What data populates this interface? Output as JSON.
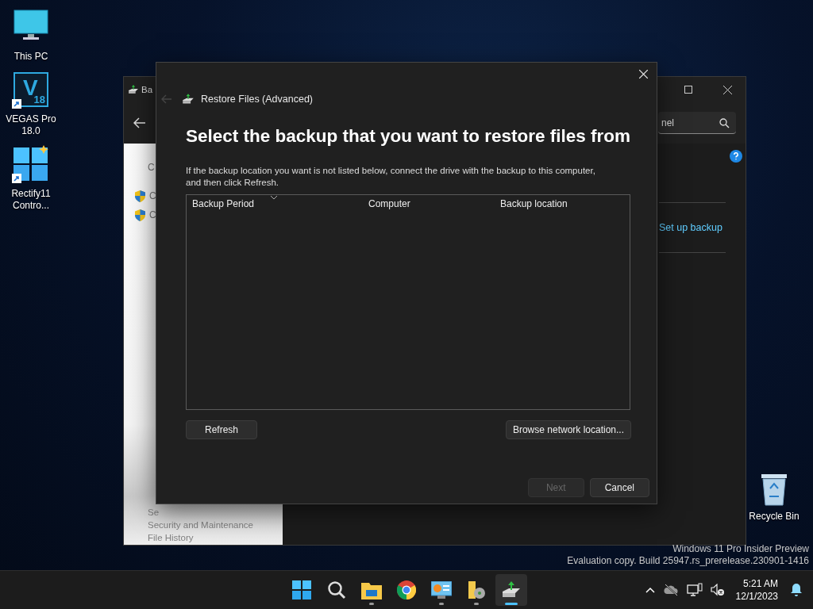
{
  "desktop_icons": [
    {
      "kind": "pc",
      "label": "This PC",
      "shortcut": false
    },
    {
      "kind": "vegas",
      "label": "VEGAS Pro 18.0",
      "glyph": "V",
      "version": "18",
      "shortcut": true
    },
    {
      "kind": "rectify",
      "label": "Rectify11 Contro...",
      "shortcut": true
    }
  ],
  "recycle_bin": {
    "label": "Recycle Bin"
  },
  "background_window": {
    "title": "Ba",
    "search": {
      "placeholder": "nel"
    },
    "sidebar_items": [
      {
        "kind": "plain",
        "label": "C"
      },
      {
        "kind": "shield",
        "label": "C"
      },
      {
        "kind": "shield",
        "label": "C"
      }
    ],
    "see_also": [
      "Se",
      "Security and Maintenance",
      "File History"
    ],
    "link": "Set up backup"
  },
  "dialog": {
    "title": "Restore Files (Advanced)",
    "back_disabled": true,
    "heading": "Select the backup that you want to restore files from",
    "description": "If the backup location you want is not listed below, connect the drive with the backup to this computer, and then click Refresh.",
    "columns": [
      {
        "label": "Backup Period",
        "sorted": true
      },
      {
        "label": "Computer",
        "sorted": false
      },
      {
        "label": "Backup location",
        "sorted": false
      }
    ],
    "list_buttons": [
      {
        "label": "Refresh",
        "disabled": false
      },
      {
        "label": "Browse network location...",
        "disabled": false
      }
    ],
    "footer_buttons": [
      {
        "label": "Next",
        "disabled": true
      },
      {
        "label": "Cancel",
        "disabled": false
      }
    ]
  },
  "watermark": [
    "Windows 11 Pro Insider Preview",
    "Evaluation copy. Build 25947.rs_prerelease.230901-1416"
  ],
  "taskbar": {
    "apps": [
      {
        "kind": "start",
        "running": false,
        "selected": false
      },
      {
        "kind": "search",
        "running": false,
        "selected": false
      },
      {
        "kind": "explorer",
        "running": true,
        "selected": false
      },
      {
        "kind": "chrome",
        "running": false,
        "selected": false
      },
      {
        "kind": "control",
        "running": true,
        "selected": false
      },
      {
        "kind": "folder",
        "running": true,
        "selected": false
      },
      {
        "kind": "backup",
        "running": true,
        "selected": true
      }
    ],
    "time": "5:21 AM",
    "date": "12/1/2023"
  }
}
